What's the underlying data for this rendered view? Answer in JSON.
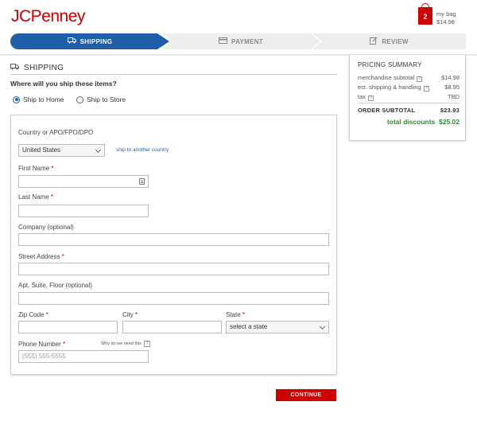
{
  "header": {
    "logo": "JCPenney",
    "bag_count": "2",
    "bag_label": "my bag",
    "bag_total": "$14.98"
  },
  "steps": [
    {
      "label": "SHIPPING",
      "icon": "truck-icon",
      "active": true
    },
    {
      "label": "PAYMENT",
      "icon": "card-icon",
      "active": false
    },
    {
      "label": "REVIEW",
      "icon": "edit-icon",
      "active": false
    }
  ],
  "shipping": {
    "title": "SHIPPING",
    "question": "Where will you ship these items?",
    "radio_home": "Ship to Home",
    "radio_store": "Ship to Store",
    "selected": "home"
  },
  "form": {
    "country_label": "Country or APO/FPO/DPO",
    "country_value": "United States",
    "ship_other_link": "ship to another country",
    "first_name_label": "First Name",
    "last_name_label": "Last Name",
    "company_label": "Company (optional)",
    "street_label": "Street Address",
    "apt_label": "Apt, Suite, Floor (optional)",
    "zip_label": "Zip Code",
    "city_label": "City",
    "state_label": "State",
    "state_placeholder": "select a state",
    "phone_label": "Phone Number",
    "phone_placeholder": "(555) 555-5555",
    "why_label": "Why do we need this",
    "req_mark": "*",
    "q_mark": "?"
  },
  "continue_label": "CONTINUE",
  "pricing": {
    "title": "PRICING SUMMARY",
    "merch_label": "merchandise subtotal",
    "merch_value": "$14.98",
    "ship_label": "est. shipping & handling",
    "ship_value": "$8.95",
    "tax_label": "tax",
    "tax_value": "TBD",
    "subtotal_label": "ORDER SUBTOTAL",
    "subtotal_value": "$23.93",
    "discount_label": "total discounts",
    "discount_value": "$25.02"
  },
  "colors": {
    "brand_red": "#cc0000",
    "active_blue": "#1f5faa",
    "discount_green": "#2e8b2e"
  }
}
